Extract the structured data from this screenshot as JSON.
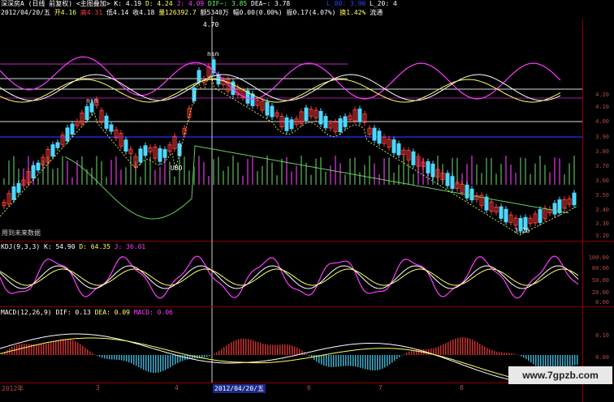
{
  "header": {
    "line1": {
      "stock": "深深房A",
      "period": "(日线 前复权)",
      "overlay": "<主图叠加>",
      "k": "K: 4.19",
      "d": "D: 4.24",
      "j": "J: 4.09",
      "dif": "DIF~: 3.85",
      "dea": "DEA~: 3.78",
      "l": "L_80: 3.90",
      "l20": "L_20: 4"
    },
    "line2": {
      "date": "2012/04/20/五",
      "open": "开4.16",
      "high": "高4.31",
      "low": "低4.14",
      "close": "收4.18",
      "vol": "量126392.7",
      "amount": "额5340万",
      "change": "幅0.00(0.00%)",
      "amp": "振0.17(4.07%)",
      "turnover": "换1.42%",
      "flow": "流通"
    }
  },
  "main_panel": {
    "labels": {
      "peak": "4.70",
      "nsn": "nsn",
      "nsn2": "nsn",
      "ubo": "UBO",
      "bottom_label": "用到未来数据",
      "low_mark": "3.26"
    },
    "y_ticks": [
      "4.20",
      "4.10",
      "4.00",
      "3.90",
      "3.80",
      "3.70",
      "3.60",
      "3.50",
      "3.40",
      "3.30",
      "3.20"
    ]
  },
  "kdj_panel": {
    "title": "KDJ(9,3,3)",
    "k": "K: 54.90",
    "d": "D: 64.35",
    "j": "J: 36.01",
    "y_ticks": [
      "100.00",
      "80.00",
      "50.00",
      "20.00",
      "0.00"
    ]
  },
  "macd_panel": {
    "title": "MACD(12,26,9)",
    "dif": "DIF: 0.13",
    "dea": "DEA: 0.09",
    "macd": "MACD: 0.06",
    "y_ticks": [
      "0.10",
      "0.00"
    ]
  },
  "x_axis": {
    "labels": [
      "2012年",
      "3",
      "4",
      "2012/04/20/五",
      "6",
      "7",
      "8"
    ]
  },
  "watermark": "www.7gpzb.com",
  "colors": {
    "bg": "#000000",
    "up": "#ff3b3b",
    "down": "#4fd8ff",
    "white": "#ffffff",
    "magenta": "#ff3cff",
    "yellow": "#ffff66",
    "green": "#66cc66",
    "axis": "#8b0000",
    "grid_purple": "#a020a0",
    "blue": "#2233ff"
  }
}
